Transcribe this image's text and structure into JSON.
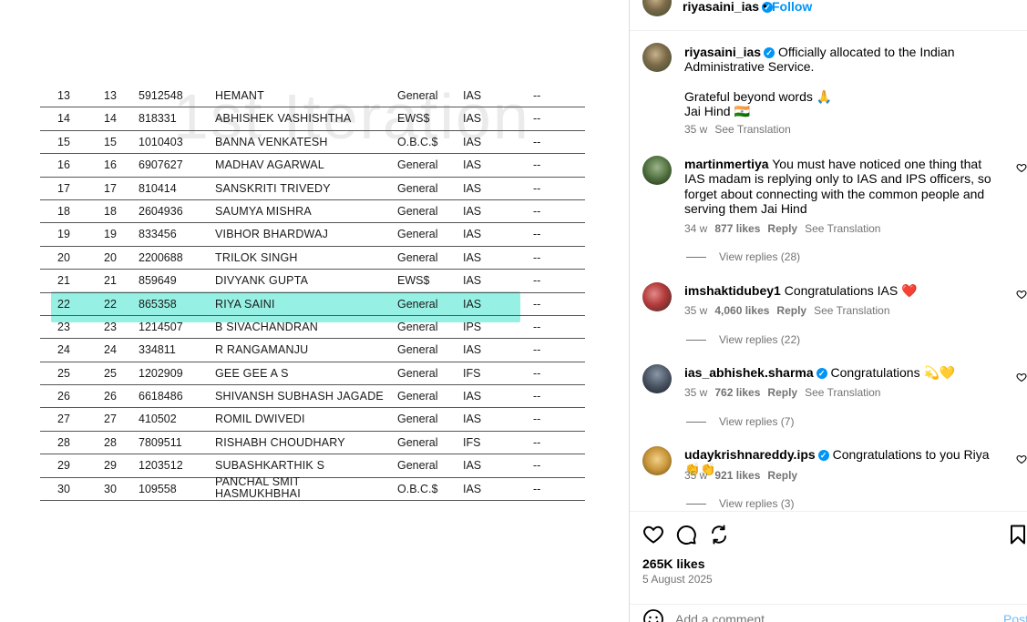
{
  "header": {
    "username": "riyasaini_ias",
    "follow_label": "Follow",
    "dot": "•",
    "more_label": "•••"
  },
  "table": {
    "watermark": "1st Iteration",
    "rows": [
      {
        "sn": "13",
        "rank": "13",
        "roll": "5912548",
        "name": "HEMANT",
        "category": "General",
        "service": "IAS",
        "dash": "--"
      },
      {
        "sn": "14",
        "rank": "14",
        "roll": "818331",
        "name": "ABHISHEK VASHISHTHA",
        "category": "EWS$",
        "service": "IAS",
        "dash": "--"
      },
      {
        "sn": "15",
        "rank": "15",
        "roll": "1010403",
        "name": "BANNA VENKATESH",
        "category": "O.B.C.$",
        "service": "IAS",
        "dash": "--"
      },
      {
        "sn": "16",
        "rank": "16",
        "roll": "6907627",
        "name": "MADHAV AGARWAL",
        "category": "General",
        "service": "IAS",
        "dash": "--"
      },
      {
        "sn": "17",
        "rank": "17",
        "roll": "810414",
        "name": "SANSKRITI TRIVEDY",
        "category": "General",
        "service": "IAS",
        "dash": "--"
      },
      {
        "sn": "18",
        "rank": "18",
        "roll": "2604936",
        "name": "SAUMYA MISHRA",
        "category": "General",
        "service": "IAS",
        "dash": "--"
      },
      {
        "sn": "19",
        "rank": "19",
        "roll": "833456",
        "name": "VIBHOR BHARDWAJ",
        "category": "General",
        "service": "IAS",
        "dash": "--"
      },
      {
        "sn": "20",
        "rank": "20",
        "roll": "2200688",
        "name": "TRILOK SINGH",
        "category": "General",
        "service": "IAS",
        "dash": "--"
      },
      {
        "sn": "21",
        "rank": "21",
        "roll": "859649",
        "name": "DIVYANK GUPTA",
        "category": "EWS$",
        "service": "IAS",
        "dash": "--"
      },
      {
        "sn": "22",
        "rank": "22",
        "roll": "865358",
        "name": "RIYA SAINI",
        "category": "General",
        "service": "IAS",
        "dash": "--"
      },
      {
        "sn": "23",
        "rank": "23",
        "roll": "1214507",
        "name": "B SIVACHANDRAN",
        "category": "General",
        "service": "IPS",
        "dash": "--"
      },
      {
        "sn": "24",
        "rank": "24",
        "roll": "334811",
        "name": "R RANGAMANJU",
        "category": "General",
        "service": "IAS",
        "dash": "--"
      },
      {
        "sn": "25",
        "rank": "25",
        "roll": "1202909",
        "name": "GEE GEE A S",
        "category": "General",
        "service": "IFS",
        "dash": "--"
      },
      {
        "sn": "26",
        "rank": "26",
        "roll": "6618486",
        "name": "SHIVANSH SUBHASH JAGADE",
        "category": "General",
        "service": "IAS",
        "dash": "--"
      },
      {
        "sn": "27",
        "rank": "27",
        "roll": "410502",
        "name": "ROMIL DWIVEDI",
        "category": "General",
        "service": "IAS",
        "dash": "--"
      },
      {
        "sn": "28",
        "rank": "28",
        "roll": "7809511",
        "name": "RISHABH CHOUDHARY",
        "category": "General",
        "service": "IFS",
        "dash": "--"
      },
      {
        "sn": "29",
        "rank": "29",
        "roll": "1203512",
        "name": "SUBASHKARTHIK S",
        "category": "General",
        "service": "IAS",
        "dash": "--"
      },
      {
        "sn": "30",
        "rank": "30",
        "roll": "109558",
        "name": "PANCHAL SMIT\nHASMUKHBHAI",
        "category": "O.B.C.$",
        "service": "IAS",
        "dash": "--"
      }
    ]
  },
  "caption": {
    "username": "riyasaini_ias",
    "line1": "Officially allocated to the Indian Administrative Service.",
    "line2": "Grateful beyond words 🙏",
    "line3": "Jai Hind 🇮🇳",
    "time": "35 w",
    "see_translation": "See Translation"
  },
  "comments": [
    {
      "username": "martinmertiya",
      "verified": false,
      "text": "You must have noticed one thing that IAS madam is replying only to IAS and IPS officers, so forget about connecting with the common people and serving them Jai Hind",
      "time": "34 w",
      "likes": "877 likes",
      "reply": "Reply",
      "translation": "See Translation",
      "view_replies": "View replies (28)"
    },
    {
      "username": "imshaktidubey1",
      "verified": false,
      "text": "Congratulations IAS ❤️",
      "time": "35 w",
      "likes": "4,060 likes",
      "reply": "Reply",
      "translation": "See Translation",
      "view_replies": "View replies (22)"
    },
    {
      "username": "ias_abhishek.sharma",
      "verified": true,
      "text": "Congratulations 💫💛",
      "time": "35 w",
      "likes": "762 likes",
      "reply": "Reply",
      "translation": "See Translation",
      "view_replies": "View replies (7)"
    },
    {
      "username": "udaykrishnareddy.ips",
      "verified": true,
      "text": "Congratulations to you Riya 👏👏",
      "time": "35 w",
      "likes": "921 likes",
      "reply": "Reply",
      "translation": "",
      "view_replies": "View replies (3)"
    }
  ],
  "actions": {
    "likes": "265K likes",
    "date": "5 August 2025",
    "icons": [
      "heart-icon",
      "comment-icon",
      "share-icon",
      "save-icon"
    ]
  },
  "add_comment": {
    "placeholder": "Add a comment...",
    "post_label": "Post"
  },
  "colors": {
    "accent": "#0095f6",
    "highlight": "#40e6cd",
    "secondary_text": "#737373"
  }
}
